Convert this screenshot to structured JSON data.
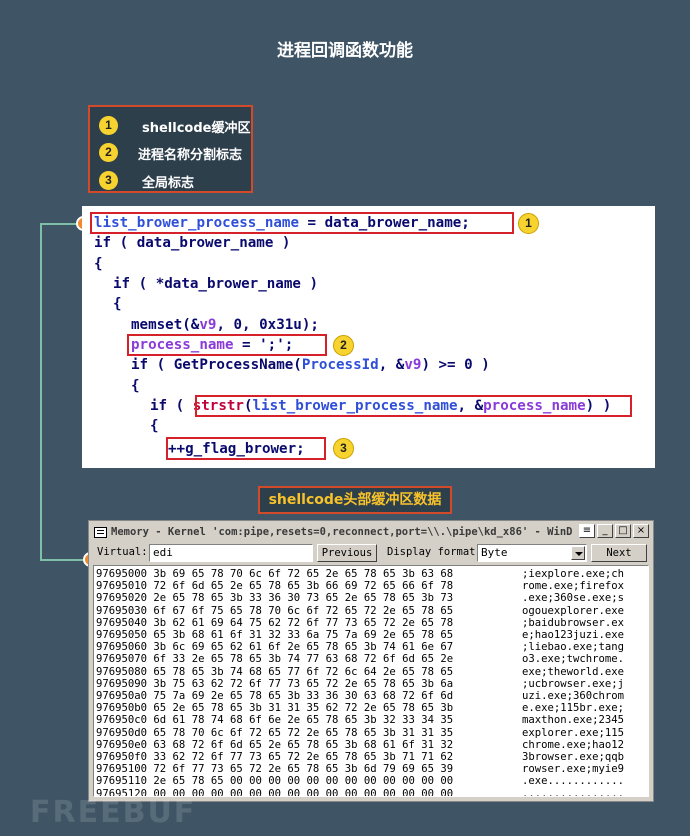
{
  "title": "进程回调函数功能",
  "legend": [
    {
      "num": "1",
      "label": "shellcode缓冲区"
    },
    {
      "num": "2",
      "label": "进程名称分割标志"
    },
    {
      "num": "3",
      "label": "全局标志"
    }
  ],
  "code": {
    "line1_var": "list_brower_process_name",
    "line1_rest": " = data_brower_name;",
    "line2": "if ( data_brower_name )",
    "line3": "{",
    "line4": "if ( *data_brower_name )",
    "line5": "{",
    "line6_a": "memset(&",
    "line6_v": "v9",
    "line6_b": ", 0, 0x31u);",
    "line7_var": "process_name",
    "line7_rest": " = ';';",
    "line8_a": "if ( GetProcessName(",
    "line8_p": "ProcessId",
    "line8_b": ", &",
    "line8_v": "v9",
    "line8_c": ") >= 0 )",
    "line9": "{",
    "line10_a": "if ( ",
    "line10_fn": "strstr",
    "line10_b": "(",
    "line10_p1": "list_brower_process_name",
    "line10_c": ", &",
    "line10_p2": "process_name",
    "line10_d": ")",
    "line10_e": " )",
    "line11": "{",
    "line12": "++g_flag_brower;"
  },
  "badges": [
    "1",
    "2",
    "3"
  ],
  "buffer_label": "shellcode头部缓冲区数据",
  "window": {
    "title": "Memory - Kernel 'com:pipe,resets=0,reconnect,port=\\\\.\\pipe\\kd_x86' - WinD",
    "virtual_label": "Virtual:",
    "virtual_value": "edi",
    "previous_label": "Previous",
    "display_format_label": "Display format:",
    "display_format_value": "Byte",
    "next_label": "Next",
    "min_label": "_",
    "max_label": "□",
    "close_label": "×"
  },
  "memory_rows": [
    {
      "addr": "97695000",
      "hex": "3b 69 65 78 70 6c 6f 72 65 2e 65 78 65 3b 63 68",
      "ascii": ";iexplore.exe;ch"
    },
    {
      "addr": "97695010",
      "hex": "72 6f 6d 65 2e 65 78 65 3b 66 69 72 65 66 6f 78",
      "ascii": "rome.exe;firefox"
    },
    {
      "addr": "97695020",
      "hex": "2e 65 78 65 3b 33 36 30 73 65 2e 65 78 65 3b 73",
      "ascii": ".exe;360se.exe;s"
    },
    {
      "addr": "97695030",
      "hex": "6f 67 6f 75 65 78 70 6c 6f 72 65 72 2e 65 78 65",
      "ascii": "ogouexplorer.exe"
    },
    {
      "addr": "97695040",
      "hex": "3b 62 61 69 64 75 62 72 6f 77 73 65 72 2e 65 78",
      "ascii": ";baidubrowser.ex"
    },
    {
      "addr": "97695050",
      "hex": "65 3b 68 61 6f 31 32 33 6a 75 7a 69 2e 65 78 65",
      "ascii": "e;hao123juzi.exe"
    },
    {
      "addr": "97695060",
      "hex": "3b 6c 69 65 62 61 6f 2e 65 78 65 3b 74 61 6e 67",
      "ascii": ";liebao.exe;tang"
    },
    {
      "addr": "97695070",
      "hex": "6f 33 2e 65 78 65 3b 74 77 63 68 72 6f 6d 65 2e",
      "ascii": "o3.exe;twchrome."
    },
    {
      "addr": "97695080",
      "hex": "65 78 65 3b 74 68 65 77 6f 72 6c 64 2e 65 78 65",
      "ascii": "exe;theworld.exe"
    },
    {
      "addr": "97695090",
      "hex": "3b 75 63 62 72 6f 77 73 65 72 2e 65 78 65 3b 6a",
      "ascii": ";ucbrowser.exe;j"
    },
    {
      "addr": "976950a0",
      "hex": "75 7a 69 2e 65 78 65 3b 33 36 30 63 68 72 6f 6d",
      "ascii": "uzi.exe;360chrom"
    },
    {
      "addr": "976950b0",
      "hex": "65 2e 65 78 65 3b 31 31 35 62 72 2e 65 78 65 3b",
      "ascii": "e.exe;115br.exe;"
    },
    {
      "addr": "976950c0",
      "hex": "6d 61 78 74 68 6f 6e 2e 65 78 65 3b 32 33 34 35",
      "ascii": "maxthon.exe;2345"
    },
    {
      "addr": "976950d0",
      "hex": "65 78 70 6c 6f 72 65 72 2e 65 78 65 3b 31 31 35",
      "ascii": "explorer.exe;115"
    },
    {
      "addr": "976950e0",
      "hex": "63 68 72 6f 6d 65 2e 65 78 65 3b 68 61 6f 31 32",
      "ascii": "chrome.exe;hao12"
    },
    {
      "addr": "976950f0",
      "hex": "33 62 72 6f 77 73 65 72 2e 65 78 65 3b 71 71 62",
      "ascii": "3browser.exe;qqb"
    },
    {
      "addr": "97695100",
      "hex": "72 6f 77 73 65 72 2e 65 78 65 3b 6d 79 69 65 39",
      "ascii": "rowser.exe;myie9"
    },
    {
      "addr": "97695110",
      "hex": "2e 65 78 65 00 00 00 00 00 00 00 00 00 00 00 00",
      "ascii": ".exe............"
    },
    {
      "addr": "97695120",
      "hex": "00 00 00 00 00 00 00 00 00 00 00 00 00 00 00 00",
      "ascii": "................"
    }
  ],
  "colors": {
    "background": "#3f5566",
    "highlight_box": "#d6202a",
    "badge": "#f7d330",
    "connector": "#7ec0a8",
    "buffer_label_text": "#f7c22a"
  }
}
